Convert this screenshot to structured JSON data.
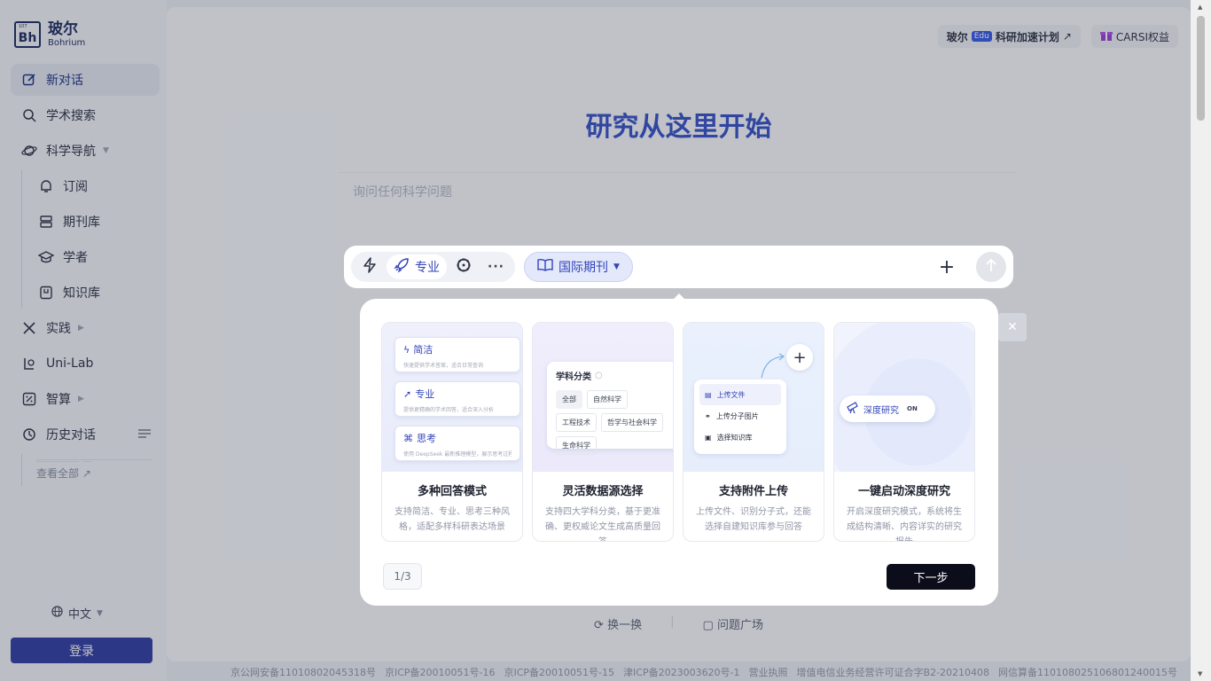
{
  "brand": {
    "name_cn": "玻尔",
    "name_en": "Bohrium",
    "mark": "Bh",
    "mark_small": "107"
  },
  "sidebar": {
    "items": [
      {
        "label": "新对话"
      },
      {
        "label": "学术搜索"
      },
      {
        "label": "科学导航"
      },
      {
        "label": "订阅"
      },
      {
        "label": "期刊库"
      },
      {
        "label": "学者"
      },
      {
        "label": "知识库"
      },
      {
        "label": "实践"
      },
      {
        "label": "Uni-Lab"
      },
      {
        "label": "智算"
      },
      {
        "label": "历史对话"
      }
    ],
    "view_all": "查看全部",
    "language": "中文",
    "login": "登录"
  },
  "header": {
    "edu_prefix": "玻尔",
    "edu_badge": "Edu",
    "edu_label": "科研加速计划",
    "carsi": "CARSI权益"
  },
  "main": {
    "hero": "研究从这里开始",
    "ask_placeholder": "询问任何科学问题",
    "refresh": "换一换",
    "square": "问题广场"
  },
  "toolbar": {
    "mode_pro": "专业",
    "source": "国际期刊"
  },
  "guide": {
    "cards": [
      {
        "title": "多种回答模式",
        "desc": "支持简洁、专业、思考三种风格，适配多样科研表达场景",
        "modes": [
          {
            "name": "简洁",
            "desc": "快速提供学术答案，适合日常查询"
          },
          {
            "name": "专业",
            "desc": "提供更精确的学术回答，适合深入分析"
          },
          {
            "name": "思考",
            "desc": "使用 DeepSeek 最新推理模型，展示思考过程"
          }
        ]
      },
      {
        "title": "灵活数据源选择",
        "desc": "支持四大学科分类，基于更准确、更权威论文生成高质量回答",
        "panel_title": "学科分类",
        "chips": [
          "全部",
          "自然科学",
          "工程技术",
          "哲学与社会科学",
          "生命科学"
        ]
      },
      {
        "title": "支持附件上传",
        "desc": "上传文件、识别分子式，还能选择自建知识库参与回答",
        "rows": [
          "上传文件",
          "上传分子图片",
          "选择知识库"
        ]
      },
      {
        "title": "一键启动深度研究",
        "desc": "开启深度研究模式，系统将生成结构清晰、内容详实的研究报告",
        "pill": "深度研究",
        "pill_state": "ON"
      }
    ],
    "page": "1/3",
    "next": "下一步"
  },
  "footer": [
    "京公网安备11010802045318号",
    "京ICP备20010051号-16",
    "京ICP备20010051号-15",
    "津ICP备2023003620号-1",
    "营业执照",
    "增值电信业务经营许可证合字B2-20210408",
    "网信算备110108025106801240015号"
  ],
  "colors": {
    "accent": "#3344b8",
    "login": "#2f3ba0",
    "next": "#0b0d1a"
  }
}
